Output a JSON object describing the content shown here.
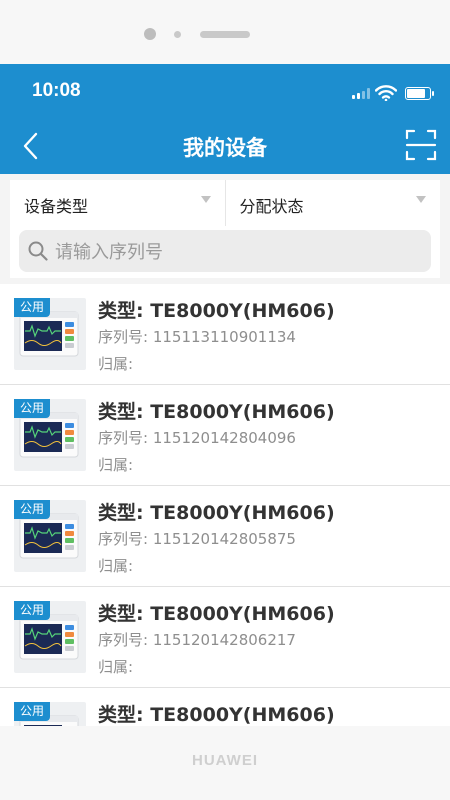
{
  "device": {
    "brand": "HUAWEI"
  },
  "status_bar": {
    "time": "10:08",
    "battery_level": 0.85,
    "signal_bars": 4,
    "signal_active_bars": 2
  },
  "nav": {
    "title": "我的设备",
    "back_icon": "chevron-left-icon",
    "scan_icon": "scan-icon"
  },
  "filters": [
    {
      "label": "设备类型"
    },
    {
      "label": "分配状态"
    }
  ],
  "search": {
    "placeholder": "请输入序列号"
  },
  "devices": [
    {
      "badge": "公用",
      "type": "类型: TE8000Y(HM606)",
      "serial": "序列号: 115113110901134",
      "owner": "归属:"
    },
    {
      "badge": "公用",
      "type": "类型: TE8000Y(HM606)",
      "serial": "序列号: 115120142804096",
      "owner": "归属:"
    },
    {
      "badge": "公用",
      "type": "类型: TE8000Y(HM606)",
      "serial": "序列号: 115120142805875",
      "owner": "归属:"
    },
    {
      "badge": "公用",
      "type": "类型: TE8000Y(HM606)",
      "serial": "序列号: 115120142806217",
      "owner": "归属:"
    },
    {
      "badge": "公用",
      "type": "类型: TE8000Y(HM606)",
      "serial": "",
      "owner": ""
    }
  ],
  "colors": {
    "primary": "#1d8ecf",
    "badge": "#1d8ecf"
  }
}
